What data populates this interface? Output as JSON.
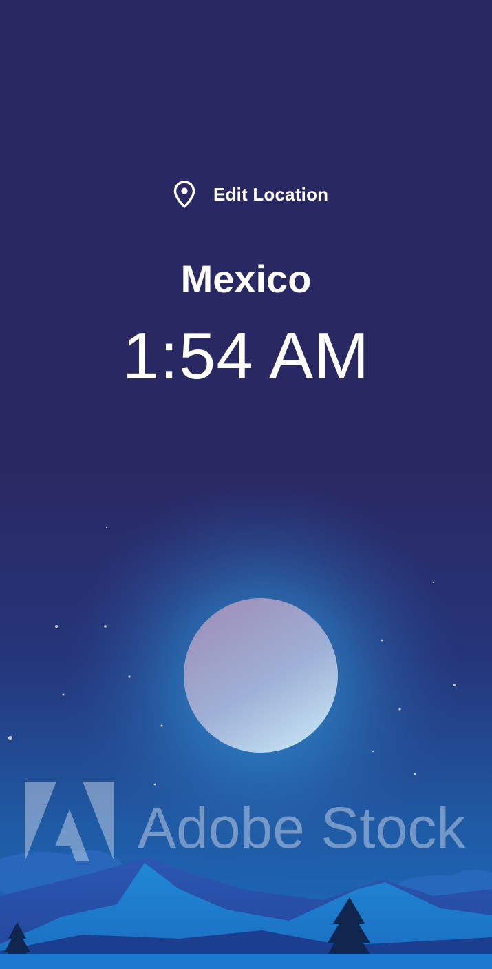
{
  "location": {
    "edit_label": "Edit Location",
    "pin_icon": "map-pin-icon"
  },
  "city": "Mexico",
  "time": "1:54 AM",
  "background": {
    "scene": "night sky with full moon, mountains and pine trees",
    "sky_color": "#2a2862",
    "moon_color": "#c9c3e0"
  },
  "watermark": {
    "text": "Adobe Stock"
  }
}
